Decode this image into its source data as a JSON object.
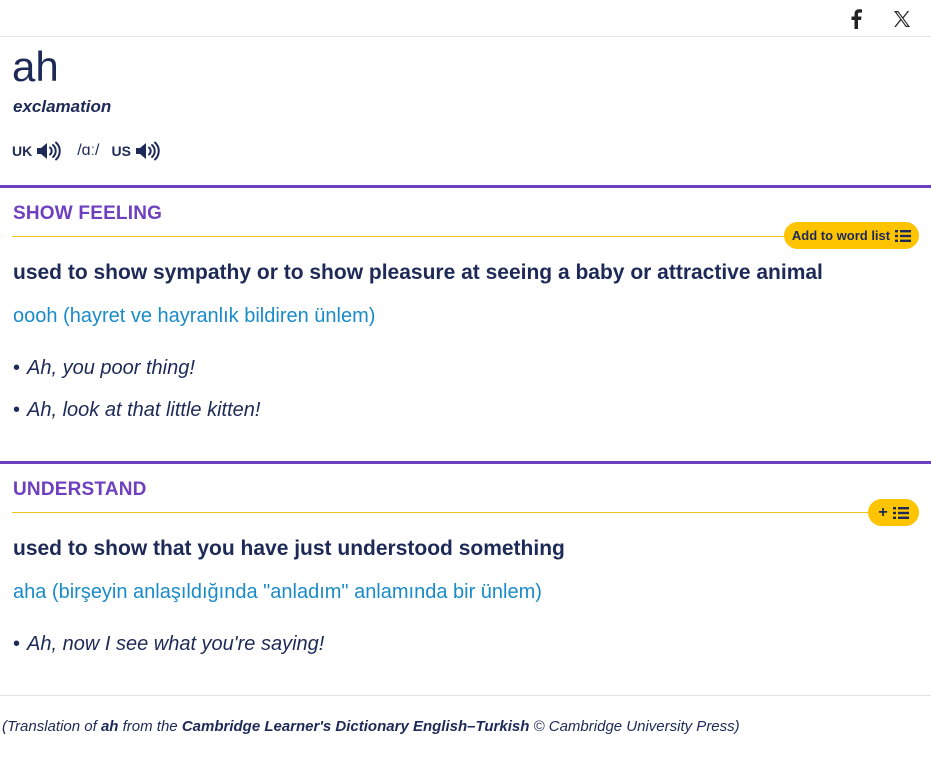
{
  "share": {
    "facebook_icon": "facebook-icon",
    "x_icon": "x-twitter-icon"
  },
  "entry": {
    "headword": "ah",
    "pos": "exclamation",
    "pron": {
      "uk_label": "UK",
      "ipa": "/ɑː/",
      "us_label": "US"
    }
  },
  "senses": [
    {
      "guideword": "SHOW FEELING",
      "wordlist_label": "Add to word list",
      "definition": "used to show sympathy or to show pleasure at seeing a baby or attractive animal",
      "translation": "oooh (hayret ve hayranlık bildiren ünlem)",
      "examples": [
        "Ah, you poor thing!",
        "Ah, look at that little kitten!"
      ]
    },
    {
      "guideword": "UNDERSTAND",
      "wordlist_label": "+",
      "definition": "used to show that you have just understood something",
      "translation": "aha (birşeyin anlaşıldığında \"anladım\" anlamında bir ünlem)",
      "examples": [
        "Ah, now I see what you're saying!"
      ]
    }
  ],
  "footer": {
    "prefix": "(Translation of ",
    "word": "ah",
    "mid": " from the ",
    "source": "Cambridge Learner's Dictionary English–Turkish",
    "suffix": " © Cambridge University Press)"
  },
  "colors": {
    "navy": "#1d2a57",
    "purple": "#6e3fbf",
    "blue": "#1a8bc9",
    "yellow": "#fec400"
  }
}
